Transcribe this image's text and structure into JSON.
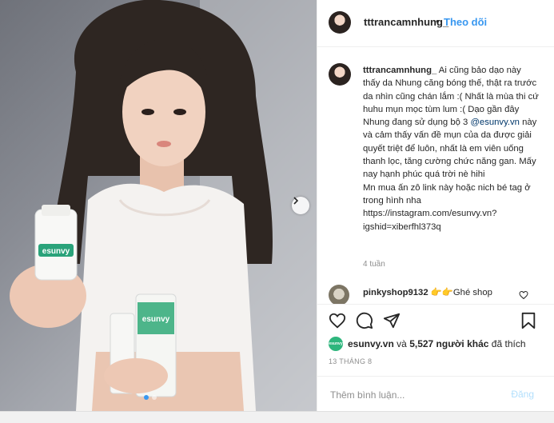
{
  "header": {
    "username": "tttrancamnhung_",
    "separator": "•",
    "follow_label": "Theo dõi"
  },
  "caption": {
    "username": "tttrancamnhung_",
    "text_before_mention": " Ai cũng bảo dạo này thấy da Nhung căng bóng thế, thật ra trước da nhìn cũng chán lắm :( Nhất là mùa thi cứ huhu mụn mọc tùm lum :( Dạo gần đây Nhung đang sử dụng bộ 3 ",
    "mention": "@esunvy.vn",
    "text_after_mention": " này và cảm thấy vấn đề mụn của da được giải quyết triệt để luôn, nhất là em viên uống thanh lọc, tăng cường chức năng gan. Mấy nay hạnh phúc quá trời nè hihi",
    "line2": "Mn mua ấn zô link này hoặc nich bé tag ở trong hình nha",
    "line3": "https://instagram.com/esunvy.vn?igshid=xiberfhl373q",
    "time": "4 tuần"
  },
  "comment2": {
    "username": "pinkyshop9132",
    "text": " 👉👉Ghé shop"
  },
  "likes": {
    "avatar_text": "esunvy",
    "user": "esunvy.vn",
    "connector": "và",
    "others": "5,527 người khác",
    "suffix": "đã thích"
  },
  "date": "13 THÁNG 8",
  "add_comment": {
    "placeholder": "Thêm bình luận...",
    "post_label": "Đăng"
  },
  "photo": {
    "bottle_brand": "esunvy",
    "tube_brand": "esunvy",
    "carousel_pages": 2,
    "carousel_active": 1
  },
  "colors": {
    "accent": "#3897f0",
    "mention": "#00376b",
    "muted": "#8e8e8e",
    "border": "#efefef"
  }
}
